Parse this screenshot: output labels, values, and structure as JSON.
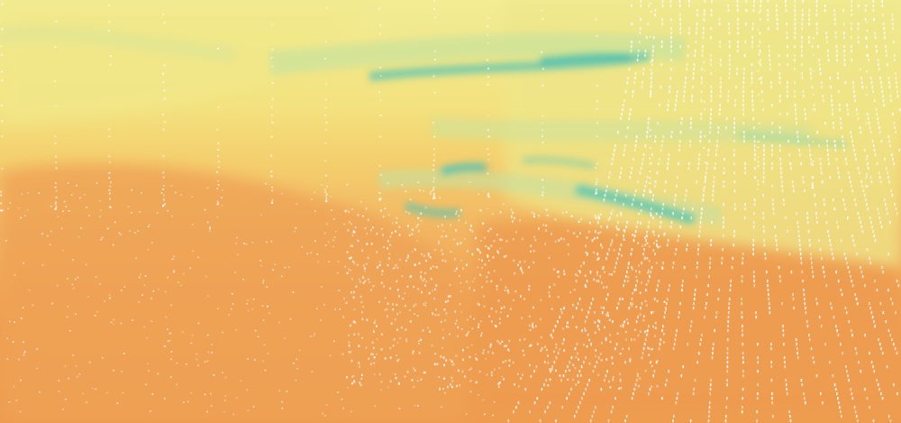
{
  "image": {
    "description_visible_text": [],
    "palette": {
      "warm_orange": "#ee9a4e",
      "orange_mid": "#f1ae5c",
      "yellow": "#f4d873",
      "pale_yellow": "#f0ea8e",
      "light_green": "#cfe39a",
      "teal": "#4fc2b6",
      "dot_color": "#ffffff"
    },
    "regions": [
      {
        "name": "upper-band",
        "color": "yellow"
      },
      {
        "name": "teal-streaks",
        "color": "teal"
      },
      {
        "name": "lower-band",
        "color": "warm_orange"
      }
    ]
  }
}
